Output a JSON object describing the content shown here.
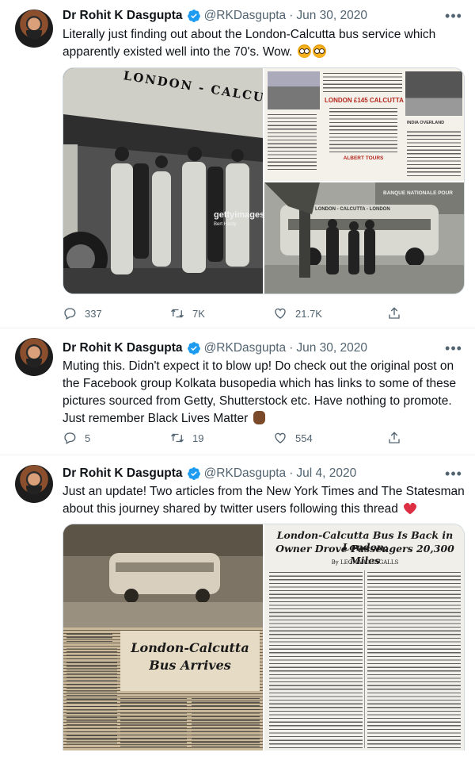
{
  "tweets": [
    {
      "author": "Dr Rohit K Dasgupta",
      "handle": "@RKDasgupta",
      "separator": "·",
      "date": "Jun 30, 2020",
      "text": "Literally just finding out about the London-Calcutta bus service which apparently existed well into the 70's. Wow.",
      "trailing_emoji": [
        "flushed-face",
        "flushed-face"
      ],
      "media": {
        "main_photo": {
          "bus_sign": "LONDON - CALCUTTA - LONDON",
          "watermark": "gettyimages",
          "watermark_sub": "Bert Hardy"
        },
        "flyer": {
          "title": "LONDON £145 CALCUTTA",
          "subtitle": "ALBERT TOURS",
          "sidebar_title": "INDIA OVERLAND"
        },
        "bottom_photo": {
          "bank_sign": "BANQUE NATIONALE POUR",
          "bus_sign": "LONDON - CALCUTTA - LONDON"
        }
      },
      "stats": {
        "replies": "337",
        "retweets": "7K",
        "likes": "21.7K"
      }
    },
    {
      "author": "Dr Rohit K Dasgupta",
      "handle": "@RKDasgupta",
      "separator": "·",
      "date": "Jun 30, 2020",
      "text": "Muting this. Didn't expect it to blow up! Do check out the original post on the Facebook group Kolkata busopedia which has links to some of these pictures sourced from Getty, Shutterstock etc. Have nothing to promote. Just remember Black Lives Matter",
      "trailing_emoji": [
        "raised-fist-medium-dark"
      ],
      "stats": {
        "replies": "5",
        "retweets": "19",
        "likes": "554"
      }
    },
    {
      "author": "Dr Rohit K Dasgupta",
      "handle": "@RKDasgupta",
      "separator": "·",
      "date": "Jul 4, 2020",
      "text": "Just an update! Two articles from the New York Times and The Statesman about this journey shared by twitter users following this thread",
      "trailing_emoji": [
        "red-heart"
      ],
      "media": {
        "left_clipping": {
          "headline_1": "London-Calcutta",
          "headline_2": "Bus Arrives"
        },
        "right_clipping": {
          "headline_1": "London-Calcutta Bus Is Back in London;",
          "headline_2": "Owner Drove Passengers 20,300 Miles",
          "byline": "By LEONARD INGALLS"
        }
      }
    }
  ],
  "colors": {
    "text": "#0f1419",
    "secondary": "#536471",
    "verified": "#1d9bf0",
    "border": "#cfd9de",
    "heart": "#e0245e"
  },
  "icons": [
    "verified-badge-icon",
    "more-icon",
    "reply-icon",
    "retweet-icon",
    "like-icon",
    "share-icon"
  ]
}
